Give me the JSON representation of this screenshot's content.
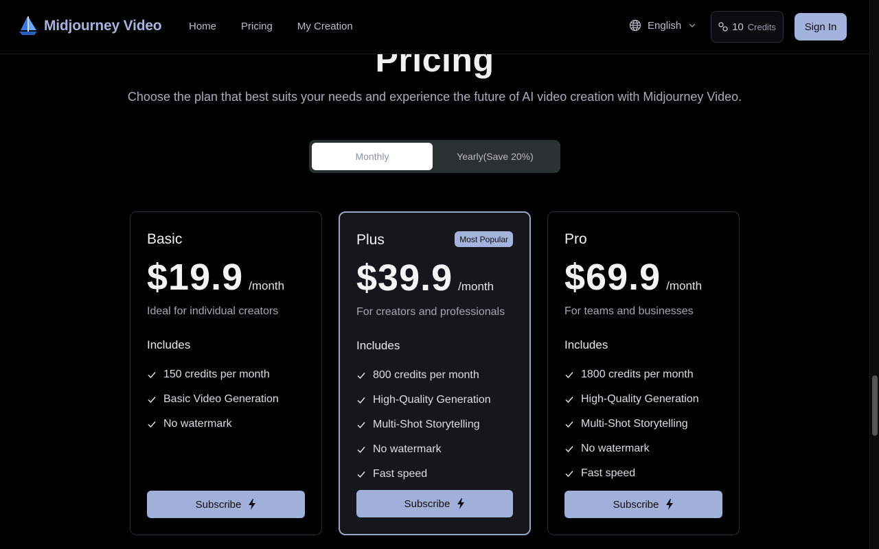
{
  "header": {
    "brand": "Midjourney Video",
    "nav": [
      "Home",
      "Pricing",
      "My Creation"
    ],
    "language": "English",
    "credits_count": "10",
    "credits_label": "Credits",
    "signin_label": "Sign In"
  },
  "hero": {
    "title": "Pricing",
    "subtitle": "Choose the plan that best suits your needs and experience the future of AI video creation with Midjourney Video."
  },
  "billing_toggle": {
    "monthly": "Monthly",
    "yearly": "Yearly(Save 20%)",
    "selected": "Monthly"
  },
  "plans": [
    {
      "name": "Basic",
      "price": "$19.9",
      "period": "/month",
      "description": "Ideal for individual creators",
      "includes_label": "Includes",
      "features": [
        "150 credits per month",
        "Basic Video Generation",
        "No watermark"
      ],
      "button": "Subscribe"
    },
    {
      "name": "Plus",
      "badge": "Most Popular",
      "price": "$39.9",
      "period": "/month",
      "description": "For creators and professionals",
      "includes_label": "Includes",
      "features": [
        "800 credits per month",
        "High-Quality Generation",
        "Multi-Shot Storytelling",
        "No watermark",
        "Fast speed"
      ],
      "button": "Subscribe"
    },
    {
      "name": "Pro",
      "price": "$69.9",
      "period": "/month",
      "description": "For teams and businesses",
      "includes_label": "Includes",
      "features": [
        "1800 credits per month",
        "High-Quality Generation",
        "Multi-Shot Storytelling",
        "No watermark",
        "Fast speed"
      ],
      "button": "Subscribe"
    }
  ],
  "colors": {
    "accent": "#a4b3db",
    "background": "#000000",
    "featured_card": "#15171c"
  },
  "icons": [
    "sailboat-logo-icon",
    "globe-icon",
    "chevron-down-icon",
    "link-credits-icon",
    "check-icon",
    "lightning-bolt-icon"
  ]
}
